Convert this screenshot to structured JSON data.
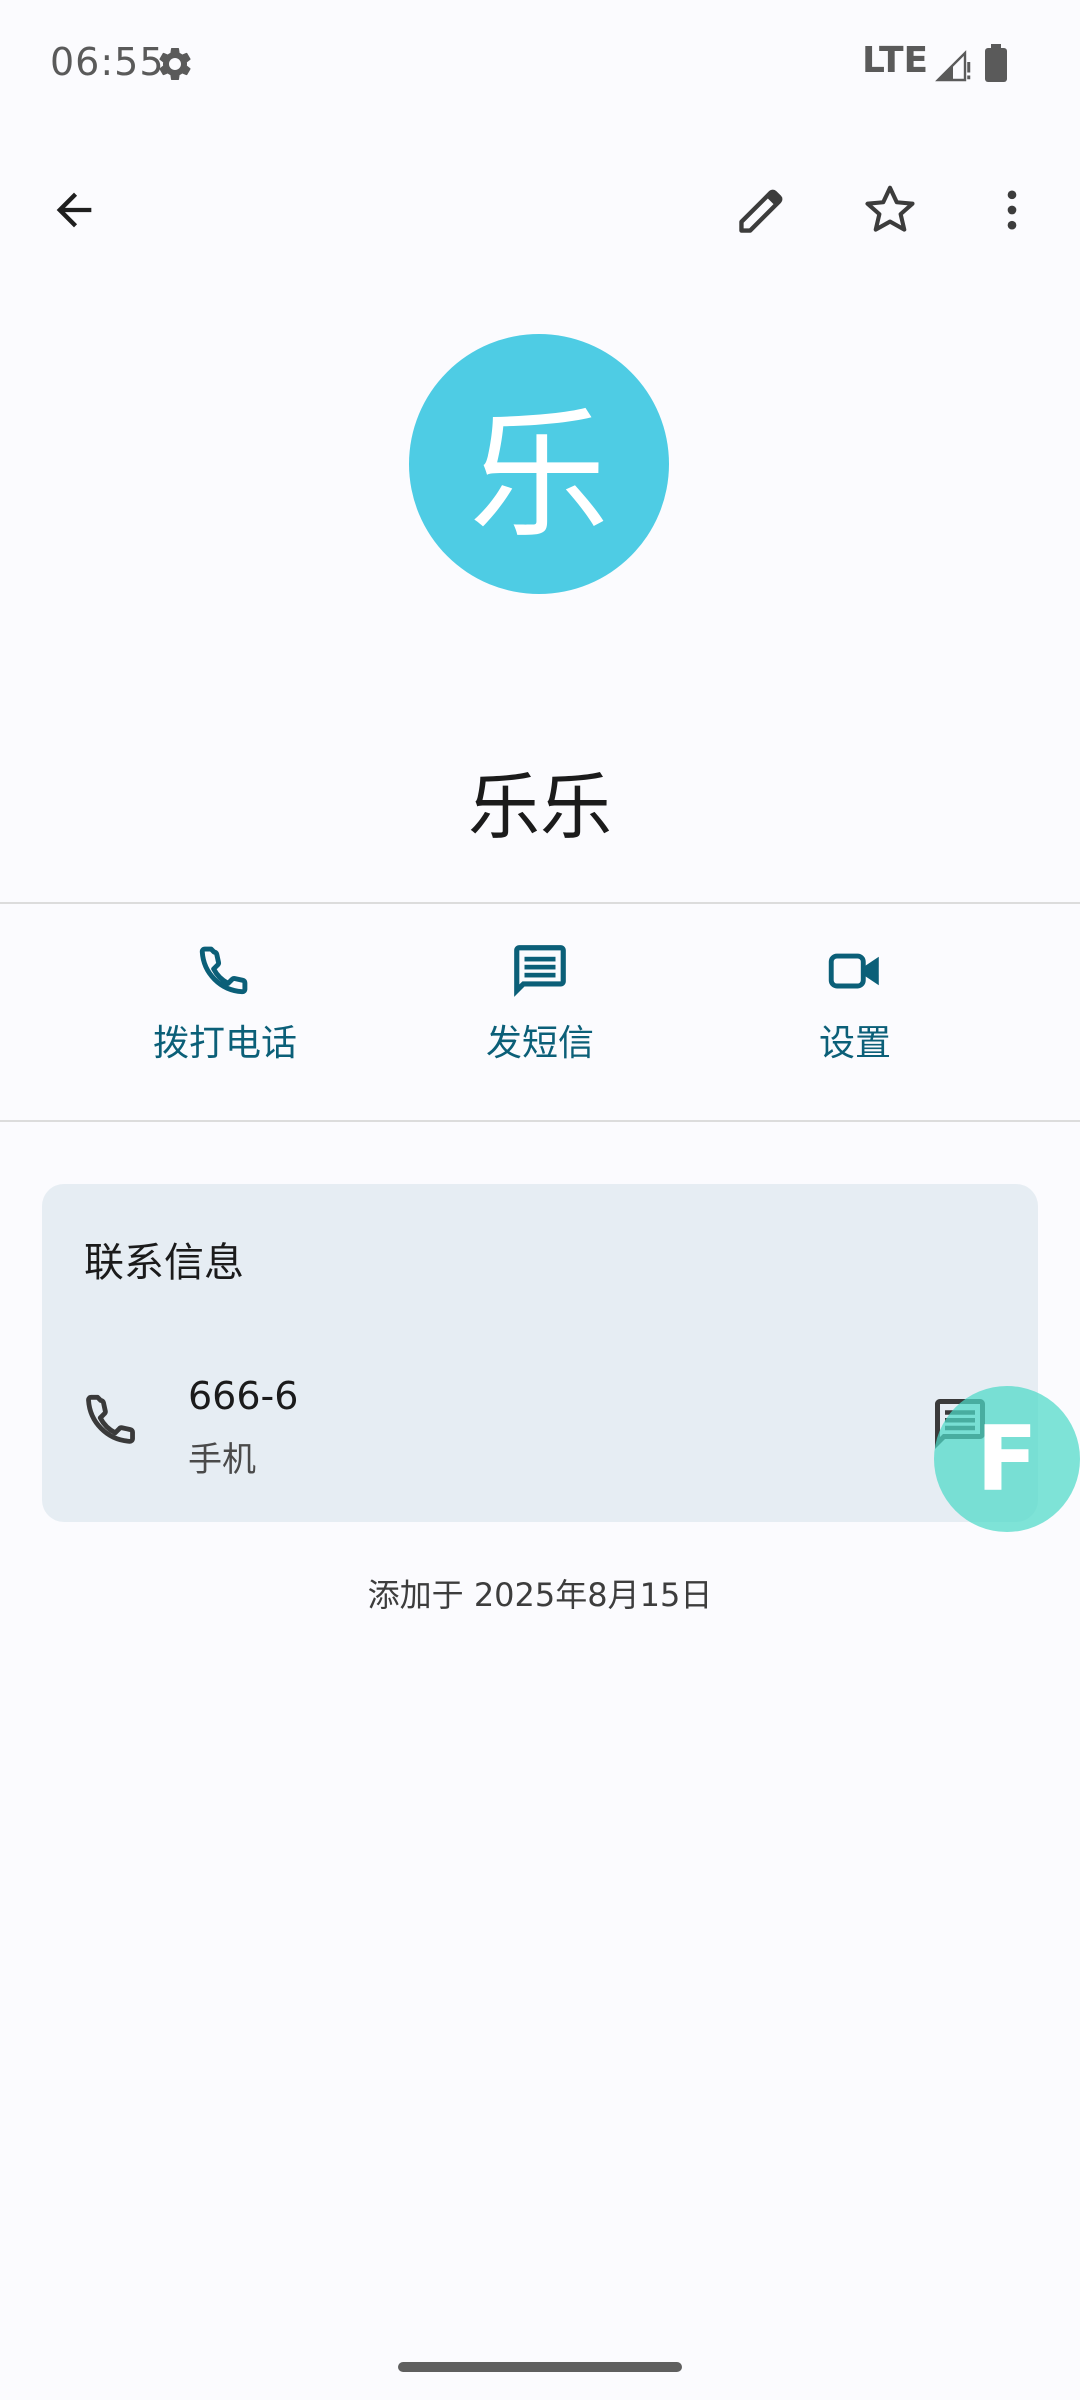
{
  "status_bar": {
    "time": "06:55",
    "network": "LTE",
    "icons": [
      "settings-gear-icon",
      "signal-icon",
      "battery-icon"
    ]
  },
  "toolbar": {
    "icons": [
      "back-arrow-icon",
      "edit-pencil-icon",
      "star-outline-icon",
      "more-vert-icon"
    ]
  },
  "contact": {
    "avatar_letter": "乐",
    "avatar_color": "#4ecce4",
    "name": "乐乐"
  },
  "actions": [
    {
      "label": "拨打电话",
      "icon": "phone-icon"
    },
    {
      "label": "发短信",
      "icon": "message-icon"
    },
    {
      "label": "设置",
      "icon": "videocam-icon"
    }
  ],
  "contact_info": {
    "title": "联系信息",
    "phone_number": "666-6",
    "phone_type": "手机"
  },
  "fab": {
    "letter": "F",
    "color": "#4dd9c8"
  },
  "added_date": "添加于 2025年8月15日",
  "colors": {
    "accent": "#0b5f78",
    "card_bg": "#e6edf3",
    "background": "#fbfbfe"
  }
}
